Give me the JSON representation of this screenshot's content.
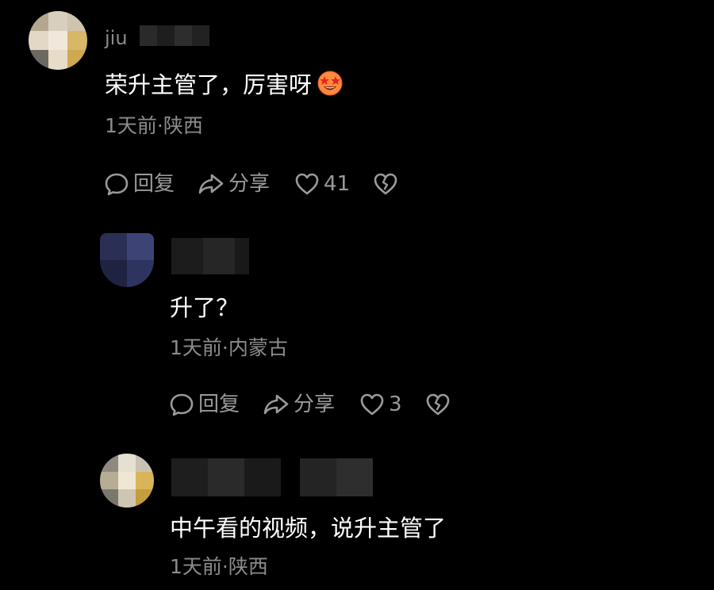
{
  "comments": [
    {
      "partial_name": "jiu",
      "text": "荣升主管了，厉害呀",
      "meta": "1天前·陕西",
      "reply_label": "回复",
      "share_label": "分享",
      "like_count": "41",
      "emoji": "star-struck-emoji"
    },
    {
      "text": "升了？",
      "meta": "1天前·内蒙古",
      "reply_label": "回复",
      "share_label": "分享",
      "like_count": "3"
    },
    {
      "text": "中午看的视频，说升主管了",
      "meta": "1天前·陕西"
    }
  ],
  "icons": {
    "reply": "comment-bubble-icon",
    "share": "share-arrow-icon",
    "like": "heart-icon",
    "dislike": "broken-heart-icon"
  },
  "colors": {
    "background": "#000000",
    "text": "#ffffff",
    "meta": "#8c8c8c",
    "action": "#9a9a9a"
  }
}
